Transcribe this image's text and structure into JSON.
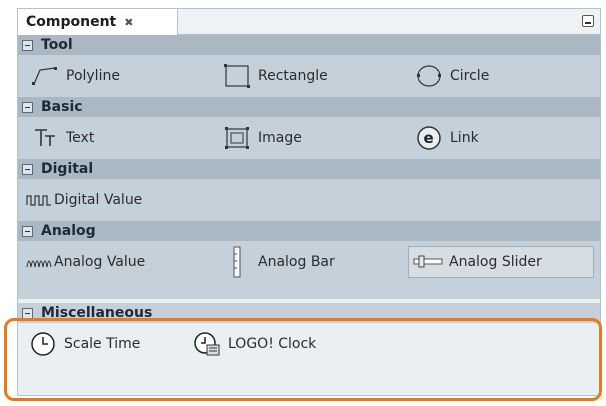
{
  "tab": {
    "title": "Component"
  },
  "groups": {
    "tool": {
      "label": "Tool",
      "items": [
        "Polyline",
        "Rectangle",
        "Circle"
      ]
    },
    "basic": {
      "label": "Basic",
      "items": [
        "Text",
        "Image",
        "Link"
      ]
    },
    "digital": {
      "label": "Digital",
      "items": [
        "Digital Value"
      ]
    },
    "analog": {
      "label": "Analog",
      "items": [
        "Analog Value",
        "Analog Bar",
        "Analog Slider"
      ]
    },
    "misc": {
      "label": "Miscellaneous",
      "items": [
        "Scale Time",
        "LOGO! Clock"
      ]
    }
  },
  "colors": {
    "highlight": "#e87a1c",
    "panel": "#c5d1da",
    "header": "#aab8c4"
  }
}
